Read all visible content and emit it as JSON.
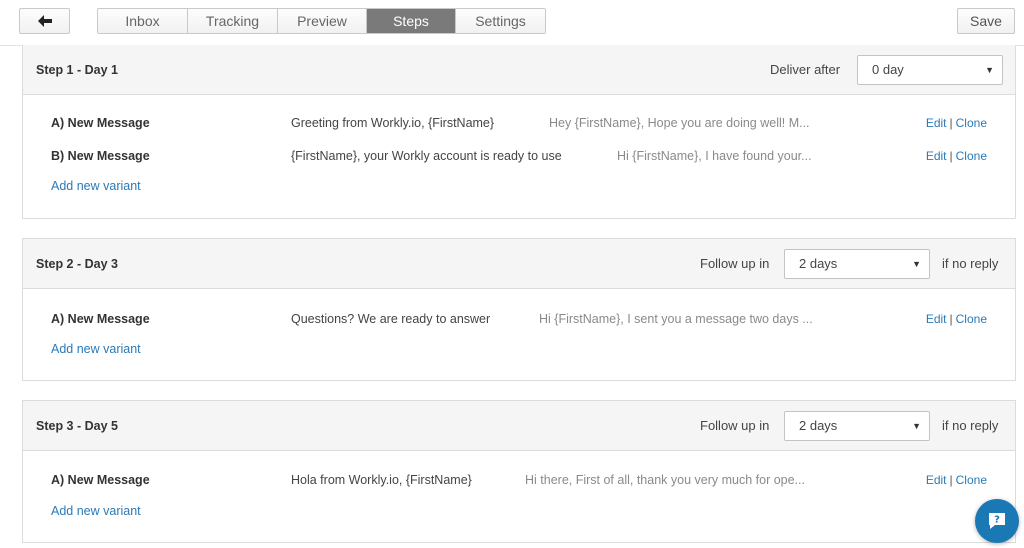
{
  "toolbar": {
    "back_icon": "arrow-left-icon",
    "tabs": [
      {
        "label": "Inbox"
      },
      {
        "label": "Tracking"
      },
      {
        "label": "Preview"
      },
      {
        "label": "Steps"
      },
      {
        "label": "Settings"
      }
    ],
    "active_tab": "Steps",
    "save_label": "Save"
  },
  "steps": [
    {
      "title": "Step 1 - Day 1",
      "control_label": "Deliver after",
      "select_value": "0 day",
      "suffix": "",
      "messages": [
        {
          "name": "A) New Message",
          "subject": "Greeting from Workly.io, {FirstName}",
          "preview": "Hey {FirstName},  Hope you are doing well!  M...",
          "edit": "Edit",
          "clone": "Clone"
        },
        {
          "name": "B) New Message",
          "subject": "{FirstName}, your Workly account is ready to use",
          "preview": "Hi {FirstName},  I have found your...",
          "edit": "Edit",
          "clone": "Clone"
        }
      ],
      "add_variant": "Add new variant"
    },
    {
      "title": "Step 2 - Day 3",
      "control_label": "Follow up in",
      "select_value": "2 days",
      "suffix": "if no reply",
      "messages": [
        {
          "name": "A) New Message",
          "subject": "Questions? We are ready to answer",
          "preview": "Hi {FirstName},  I sent you a message two days ...",
          "edit": "Edit",
          "clone": "Clone"
        }
      ],
      "add_variant": "Add new variant"
    },
    {
      "title": "Step 3 - Day 5",
      "control_label": "Follow up in",
      "select_value": "2 days",
      "suffix": "if no reply",
      "messages": [
        {
          "name": "A) New Message",
          "subject": "Hola from Workly.io, {FirstName}",
          "preview": "Hi there,  First of all, thank you very much for ope...",
          "edit": "Edit",
          "clone": "Clone"
        }
      ],
      "add_variant": "Add new variant"
    }
  ],
  "help_icon": "help-chat-icon",
  "colors": {
    "accent": "#2a7ab8",
    "active_tab": "#7a7a7a",
    "help_bubble": "#1a78b5"
  }
}
